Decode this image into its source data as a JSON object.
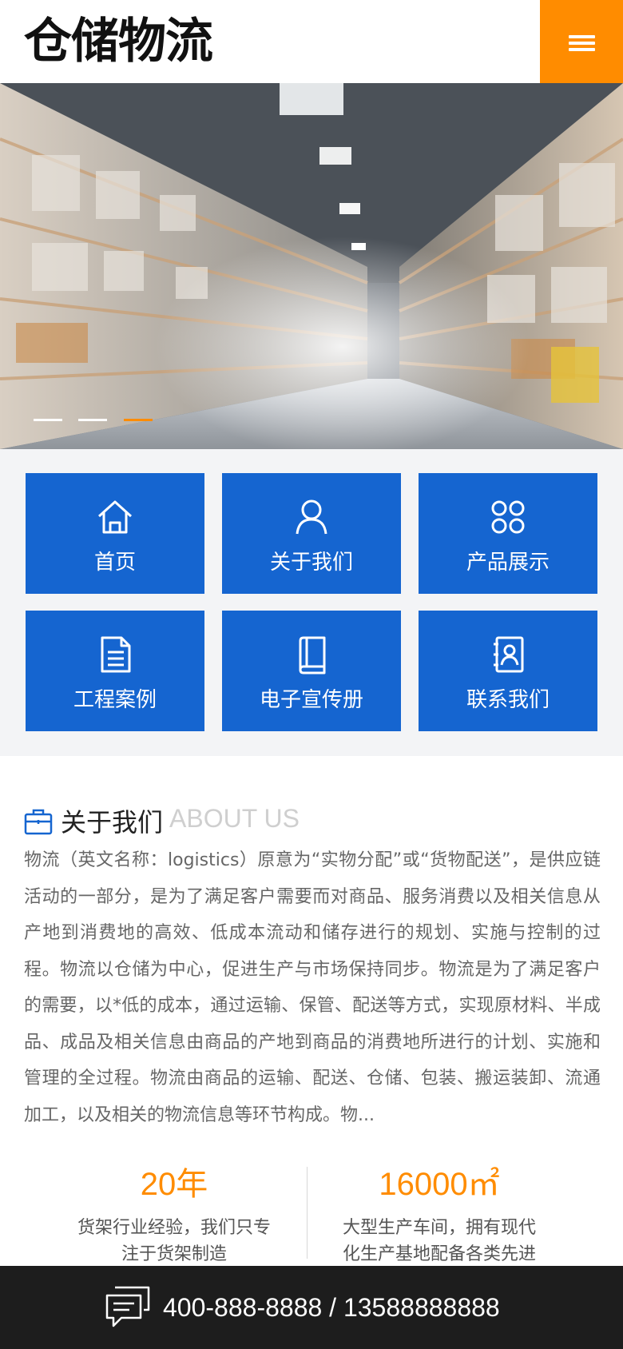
{
  "header": {
    "logo_text": "仓储物流",
    "menu_icon": "hamburger-menu-icon",
    "accent_color": "#ff8c00"
  },
  "banner": {
    "image": "warehouse-aisle-photo",
    "slides": 3,
    "active_slide": 3
  },
  "nav_tiles": {
    "color": "#1565d0",
    "items": [
      {
        "label": "首页",
        "icon": "home-icon"
      },
      {
        "label": "关于我们",
        "icon": "user-icon"
      },
      {
        "label": "产品展示",
        "icon": "grid-icon"
      },
      {
        "label": "工程案例",
        "icon": "document-icon"
      },
      {
        "label": "电子宣传册",
        "icon": "book-icon"
      },
      {
        "label": "联系我们",
        "icon": "contact-card-icon"
      }
    ]
  },
  "about": {
    "icon": "briefcase-icon",
    "title_cn": "关于我们",
    "title_en": "ABOUT US",
    "text": "物流（英文名称：logistics）原意为“实物分配”或“货物配送”，是供应链活动的一部分，是为了满足客户需要而对商品、服务消费以及相关信息从产地到消费地的高效、低成本流动和储存进行的规划、实施与控制的过程。物流以仓储为中心，促进生产与市场保持同步。物流是为了满足客户的需要，以*低的成本，通过运输、保管、配送等方式，实现原材料、半成品、成品及相关信息由商品的产地到商品的消费地所进行的计划、实施和管理的全过程。物流由商品的运输、配送、仓储、包装、搬运装卸、流通加工，以及相关的物流信息等环节构成。物..."
  },
  "stats": [
    {
      "number": "20年",
      "unit_sup": "",
      "desc": "货架行业经验，我们只专注于货架制造"
    },
    {
      "number": "16000㎡",
      "unit_sup": "2",
      "desc": "大型生产车间，拥有现代化生产基地配备各类先进生产设备，是华中地区*"
    }
  ],
  "footer": {
    "icon": "chat-bubble-icon",
    "phone": "400-888-8888 / 13588888888"
  }
}
